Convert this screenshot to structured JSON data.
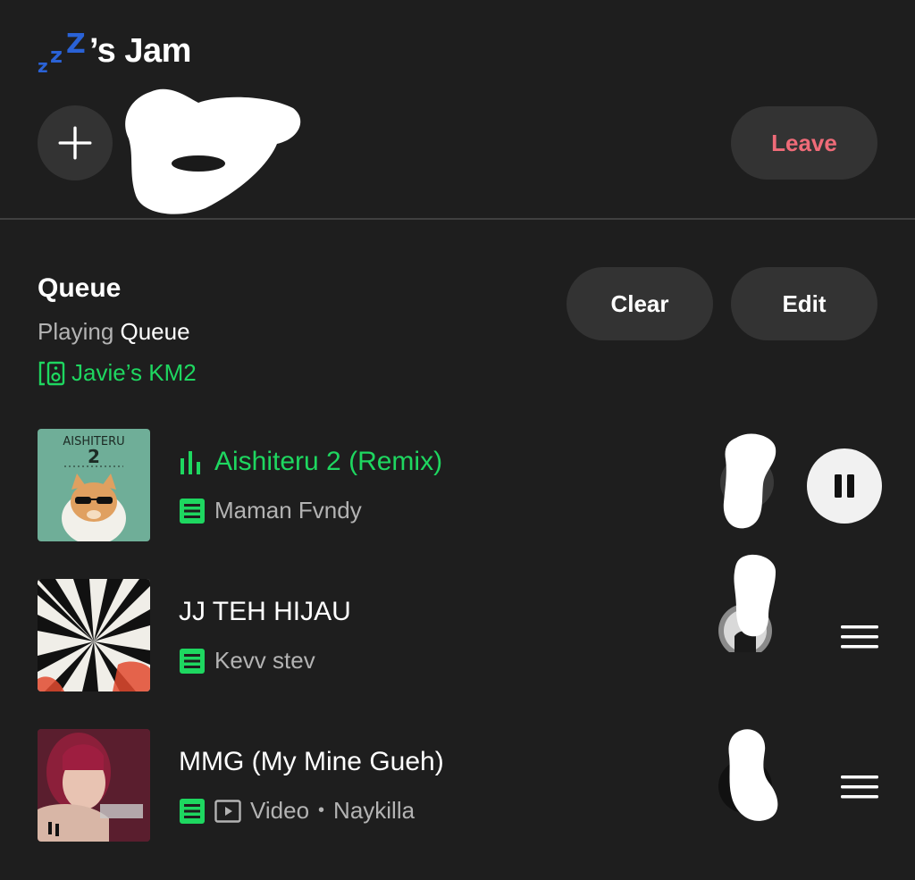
{
  "header": {
    "zzz_glyphs": [
      "z",
      "z",
      "Z"
    ],
    "title_suffix": "’s Jam",
    "leave_label": "Leave"
  },
  "queue": {
    "title": "Queue",
    "subtitle_prefix": "Playing ",
    "subtitle_highlight": "Queue",
    "device_name": "Javie’s KM2",
    "clear_label": "Clear",
    "edit_label": "Edit"
  },
  "tracks": [
    {
      "title": "Aishiteru 2 (Remix)",
      "artist": "Maman Fvndy",
      "playing": true,
      "art_text": "AISHITERU",
      "art_number": "2"
    },
    {
      "title": "JJ TEH HIJAU",
      "artist": "Kevv stev",
      "playing": false
    },
    {
      "title": "MMG (My Mine Gueh)",
      "type_label": "Video",
      "artist": "Naykilla",
      "playing": false
    }
  ],
  "colors": {
    "background": "#1e1e1e",
    "accent_green": "#1ed760",
    "leave_red": "#ef6b78",
    "zzz_blue": "#2a62d6",
    "pill_bg": "#333333"
  }
}
